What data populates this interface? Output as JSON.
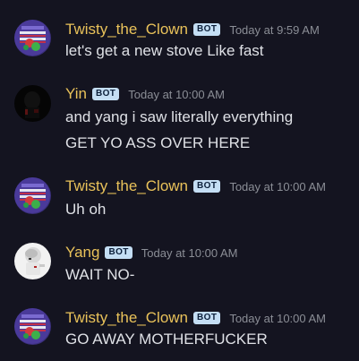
{
  "messages": [
    {
      "author": "Twisty_the_Clown",
      "badge": "BOT",
      "timestamp": "Today at 9:59 AM",
      "avatar_icon": "clown-avatar-icon",
      "lines": [
        "let's get a new stove Like fast"
      ]
    },
    {
      "author": "Yin",
      "badge": "BOT",
      "timestamp": "Today at 10:00 AM",
      "avatar_icon": "dark-figure-avatar-icon",
      "lines": [
        "and yang i saw literally everything",
        "GET YO ASS OVER HERE"
      ]
    },
    {
      "author": "Twisty_the_Clown",
      "badge": "BOT",
      "timestamp": "Today at 10:00 AM",
      "avatar_icon": "clown-avatar-icon",
      "lines": [
        "Uh oh"
      ]
    },
    {
      "author": "Yang",
      "badge": "BOT",
      "timestamp": "Today at 10:00 AM",
      "avatar_icon": "white-figure-avatar-icon",
      "lines": [
        "WAIT NO-"
      ]
    },
    {
      "author": "Twisty_the_Clown",
      "badge": "BOT",
      "timestamp": "Today at 10:00 AM",
      "avatar_icon": "clown-avatar-icon",
      "lines": [
        "GO AWAY MOTHERFUCKER"
      ]
    }
  ],
  "colors": {
    "background": "#141420",
    "username": "#e9c25a",
    "badge_bg": "#c4def4",
    "timestamp": "#8b8e96",
    "message_text": "#dfe1e6"
  }
}
